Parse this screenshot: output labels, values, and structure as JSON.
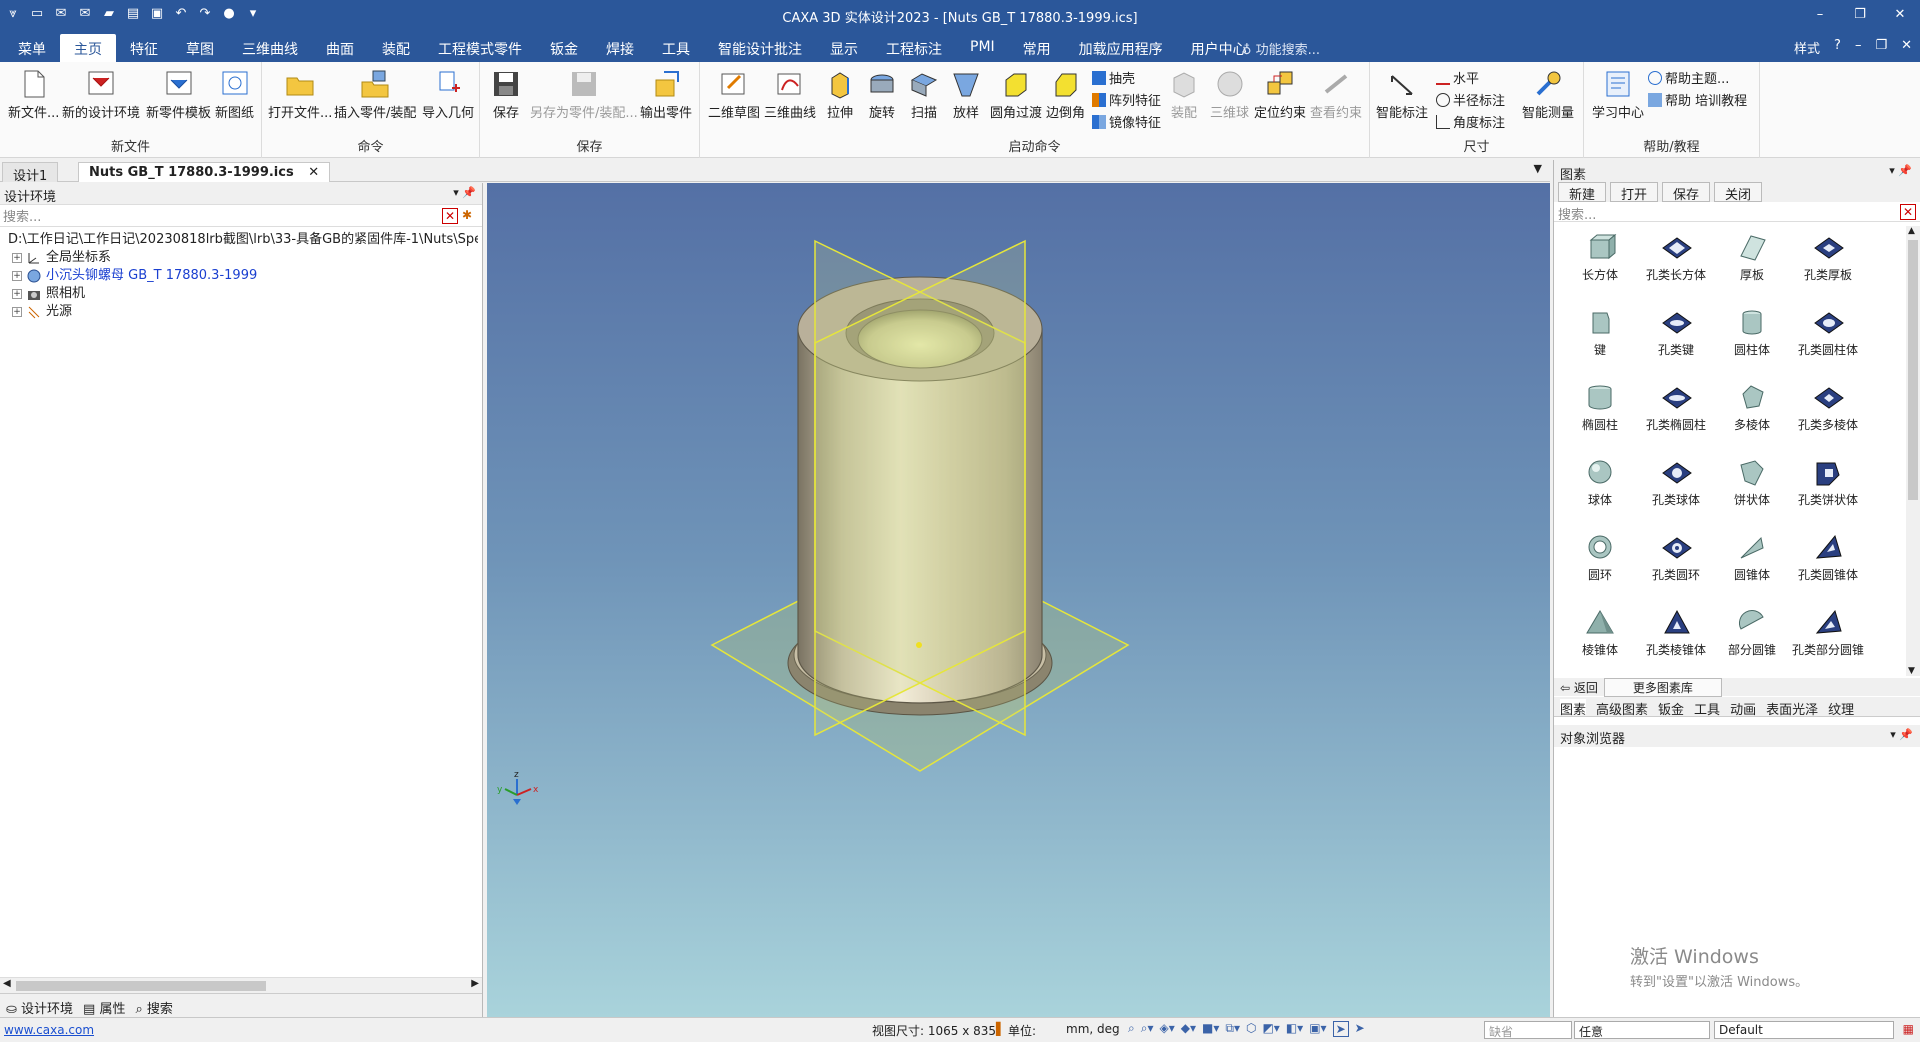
{
  "titlebar": {
    "title": "CAXA 3D 实体设计2023 - [Nuts GB_T 17880.3-1999.ics]",
    "minimize": "–",
    "restore": "❐",
    "close": "✕"
  },
  "menu": {
    "tabs": [
      "菜单",
      "主页",
      "特征",
      "草图",
      "三维曲线",
      "曲面",
      "装配",
      "工程模式零件",
      "钣金",
      "焊接",
      "工具",
      "智能设计批注",
      "显示",
      "工程标注",
      "PMI",
      "常用",
      "加载应用程序",
      "用户中心"
    ],
    "active_index": 1,
    "search_placeholder": "功能搜索...",
    "style_label": "样式"
  },
  "ribbon": {
    "new_file": {
      "label": "新文件",
      "buttons": [
        "新文件...",
        "新的设计环境",
        "新零件模板",
        "新图纸"
      ]
    },
    "command": {
      "label": "命令",
      "buttons": [
        "打开文件...",
        "插入零件/装配",
        "导入几何"
      ]
    },
    "save": {
      "label": "保存",
      "buttons": [
        "保存",
        "另存为零件/装配...",
        "输出零件"
      ]
    },
    "launch": {
      "label": "启动命令",
      "buttons": [
        "二维草图",
        "三维曲线",
        "拉伸",
        "旋转",
        "扫描",
        "放样",
        "圆角过渡",
        "边倒角"
      ],
      "small": [
        "抽壳",
        "阵列特征",
        "镜像特征"
      ],
      "disabled": [
        "装配",
        "三维球",
        "定位约束",
        "查看约束"
      ]
    },
    "dimension": {
      "label": "尺寸",
      "buttons": [
        "智能标注",
        "智能测量"
      ],
      "small": [
        "水平",
        "半径标注",
        "角度标注"
      ]
    },
    "help": {
      "label": "帮助/教程",
      "buttons": [
        "学习中心"
      ],
      "small": [
        "帮助主题...",
        "帮助 培训教程"
      ]
    }
  },
  "doc_tabs": [
    "设计1",
    "Nuts GB_T 17880.3-1999.ics"
  ],
  "left_panel": {
    "title": "设计环境",
    "search_placeholder": "搜索...",
    "tree": [
      "D:\\工作日记\\工作日记\\20230818lrb截图\\lrb\\33-具备GB的紧固件库-1\\Nuts\\Specia",
      "全局坐标系",
      "小沉头铆螺母 GB_T 17880.3-1999",
      "照相机",
      "光源"
    ],
    "bottom_tabs": [
      "设计环境",
      "属性",
      "搜索"
    ]
  },
  "right_panel": {
    "title": "图素",
    "toolbar": [
      "新建",
      "打开",
      "保存",
      "关闭"
    ],
    "search_placeholder": "搜索...",
    "items": [
      "长方体",
      "孔类长方体",
      "厚板",
      "孔类厚板",
      "键",
      "孔类键",
      "圆柱体",
      "孔类圆柱体",
      "椭圆柱",
      "孔类椭圆柱",
      "多棱体",
      "孔类多棱体",
      "球体",
      "孔类球体",
      "饼状体",
      "孔类饼状体",
      "圆环",
      "孔类圆环",
      "圆锥体",
      "孔类圆锥体",
      "棱锥体",
      "孔类棱锥体",
      "部分圆锥",
      "孔类部分圆锥"
    ],
    "back": "返回",
    "more": "更多图素库",
    "lib_tabs": [
      "图素",
      "高级图素",
      "钣金",
      "工具",
      "动画",
      "表面光泽",
      "纹理"
    ],
    "object_browser": "对象浏览器",
    "watermark_1": "激活 Windows",
    "watermark_2": "转到\"设置\"以激活 Windows。"
  },
  "status": {
    "link": "www.caxa.com",
    "view_size": "视图尺寸: 1065 x  835",
    "unit_label": "单位:",
    "unit_value": "mm, deg",
    "select1": "缺省",
    "select2": "任意",
    "select3": "Default"
  },
  "axes": {
    "x": "x",
    "y": "y",
    "z": "z"
  }
}
